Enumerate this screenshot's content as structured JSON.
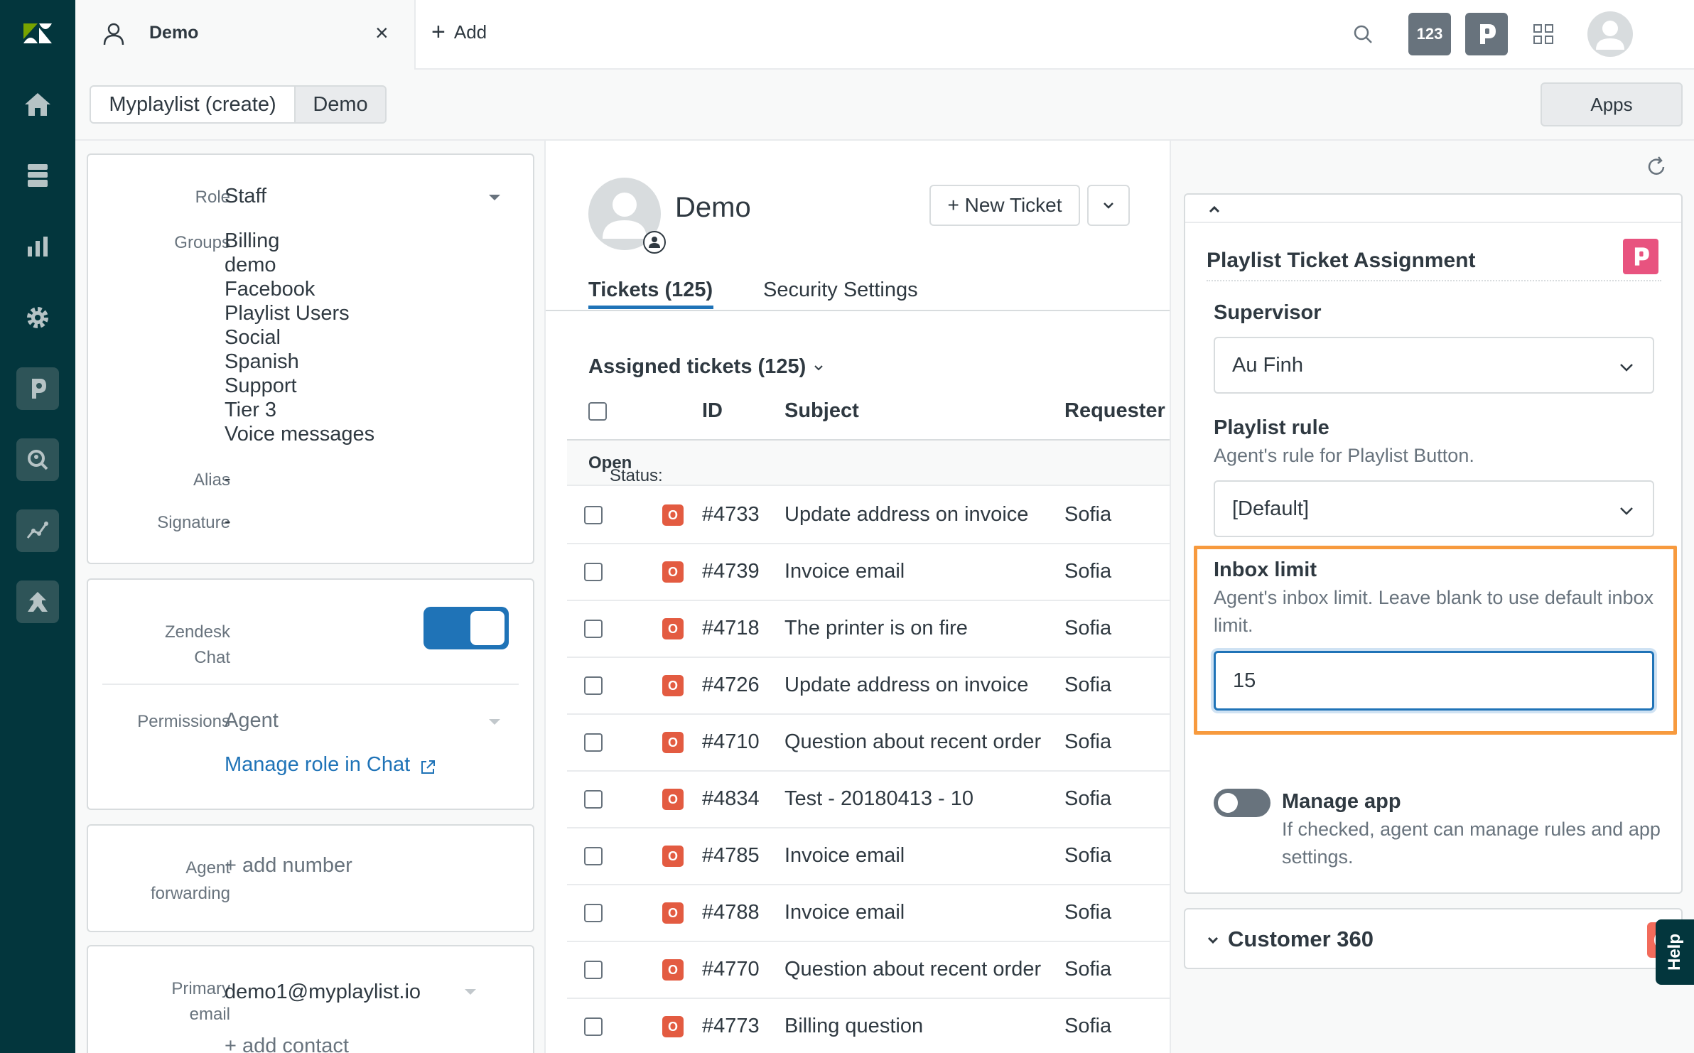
{
  "topbar": {
    "tab_title": "Demo",
    "tab_close": "×",
    "add_plus": "+",
    "add_label": "Add",
    "badge_123": "123",
    "badge_p": "P"
  },
  "subbar": {
    "seg_create": "Myplaylist (create)",
    "seg_demo": "Demo",
    "apps": "Apps"
  },
  "user_panel": {
    "role_label": "Role",
    "role_value": "Staff",
    "groups_label": "Groups",
    "groups": [
      "Billing",
      "demo",
      "Facebook",
      "Playlist Users",
      "Social",
      "Spanish",
      "Support",
      "Tier 3",
      "Voice messages"
    ],
    "alias_label": "Alias",
    "alias_value": "-",
    "signature_label": "Signature",
    "signature_value": "-",
    "chat_label_1": "Zendesk",
    "chat_label_2": "Chat",
    "chat_enabled": true,
    "permissions_label": "Permissions",
    "permissions_value": "Agent",
    "manage_role_link": "Manage role in Chat",
    "forwarding_label_1": "Agent",
    "forwarding_label_2": "forwarding",
    "add_number": "+ add number",
    "email_label_1": "Primary",
    "email_label_2": "email",
    "email_value": "demo1@myplaylist.io",
    "add_contact": "+ add contact"
  },
  "middle": {
    "user_name": "Demo",
    "new_ticket": "+ New Ticket",
    "tab_tickets": "Tickets (125)",
    "tab_security": "Security Settings",
    "assigned_header": "Assigned tickets (125)",
    "col_id": "ID",
    "col_subject": "Subject",
    "col_requester": "Requester",
    "status_prefix": "Status: ",
    "status_value": "Open",
    "tickets": [
      {
        "badge": "O",
        "id": "#4733",
        "subject": "Update address on invoice",
        "requester": "Sofia"
      },
      {
        "badge": "O",
        "id": "#4739",
        "subject": "Invoice email",
        "requester": "Sofia"
      },
      {
        "badge": "O",
        "id": "#4718",
        "subject": "The printer is on fire",
        "requester": "Sofia"
      },
      {
        "badge": "O",
        "id": "#4726",
        "subject": "Update address on invoice",
        "requester": "Sofia"
      },
      {
        "badge": "O",
        "id": "#4710",
        "subject": "Question about recent order",
        "requester": "Sofia"
      },
      {
        "badge": "O",
        "id": "#4834",
        "subject": "Test - 20180413 - 10",
        "requester": "Sofia"
      },
      {
        "badge": "O",
        "id": "#4785",
        "subject": "Invoice email",
        "requester": "Sofia"
      },
      {
        "badge": "O",
        "id": "#4788",
        "subject": "Invoice email",
        "requester": "Sofia"
      },
      {
        "badge": "O",
        "id": "#4770",
        "subject": "Question about recent order",
        "requester": "Sofia"
      },
      {
        "badge": "O",
        "id": "#4773",
        "subject": "Billing question",
        "requester": "Sofia"
      }
    ]
  },
  "app": {
    "title": "Playlist Ticket Assignment",
    "logo_letter": "P",
    "supervisor_label": "Supervisor",
    "supervisor_value": "Au Finh",
    "rule_label": "Playlist rule",
    "rule_hint": "Agent's rule for Playlist Button.",
    "rule_value": "[Default]",
    "inbox_label": "Inbox limit",
    "inbox_hint": "Agent's inbox limit. Leave blank to use default inbox limit.",
    "inbox_value": "15",
    "manage_label": "Manage app",
    "manage_hint": "If checked, agent can manage rules and app settings.",
    "manage_enabled": false,
    "c360_title": "Customer 360",
    "help": "Help"
  },
  "colors": {
    "nav_bg": "#03363d",
    "accent_blue": "#1f73b7",
    "open_badge": "#e35b41",
    "highlight": "#f79a3e",
    "playlist_pink": "#e8537f"
  }
}
